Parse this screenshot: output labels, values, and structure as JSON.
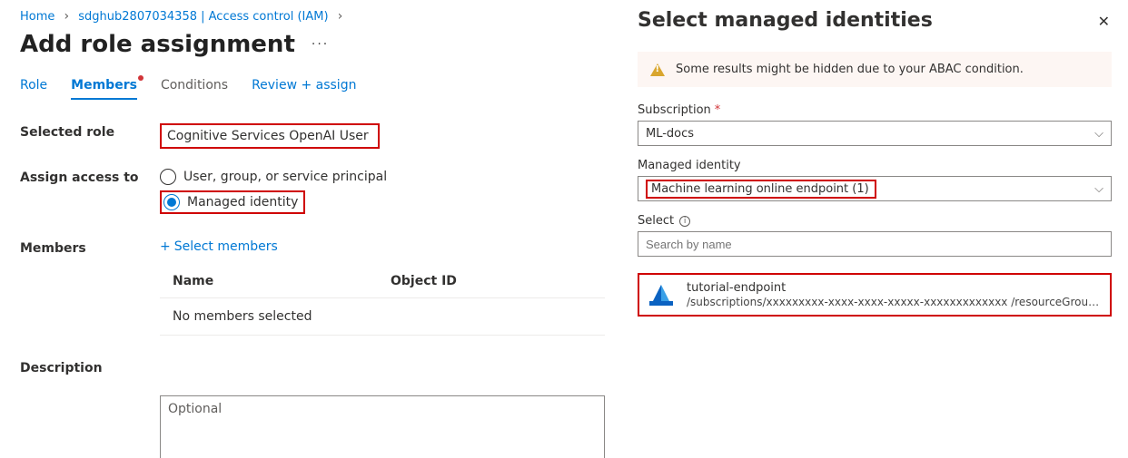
{
  "breadcrumb": {
    "home": "Home",
    "resource": "sdghub2807034358 | Access control (IAM)"
  },
  "page_title": "Add role assignment",
  "tabs": {
    "role": "Role",
    "members": "Members",
    "conditions": "Conditions",
    "review": "Review + assign"
  },
  "form": {
    "selected_role_label": "Selected role",
    "selected_role_value": "Cognitive Services OpenAI User",
    "assign_access_label": "Assign access to",
    "option_usp": "User, group, or service principal",
    "option_mi": "Managed identity",
    "members_label": "Members",
    "select_members_link": "Select members",
    "table_col_name": "Name",
    "table_col_object": "Object ID",
    "table_empty": "No members selected",
    "description_label": "Description",
    "description_placeholder": "Optional"
  },
  "panel": {
    "title": "Select managed identities",
    "alert": "Some results might be hidden due to your ABAC condition.",
    "subscription_label": "Subscription",
    "subscription_value": "ML-docs",
    "mi_label": "Managed identity",
    "mi_value": "Machine learning online endpoint (1)",
    "select_label": "Select",
    "search_placeholder": "Search by name",
    "result_name": "tutorial-endpoint",
    "result_path": "/subscriptions/xxxxxxxxx-xxxx-xxxx-xxxxx-xxxxxxxxxxxxx /resourceGroups/sdg-ai-..."
  }
}
